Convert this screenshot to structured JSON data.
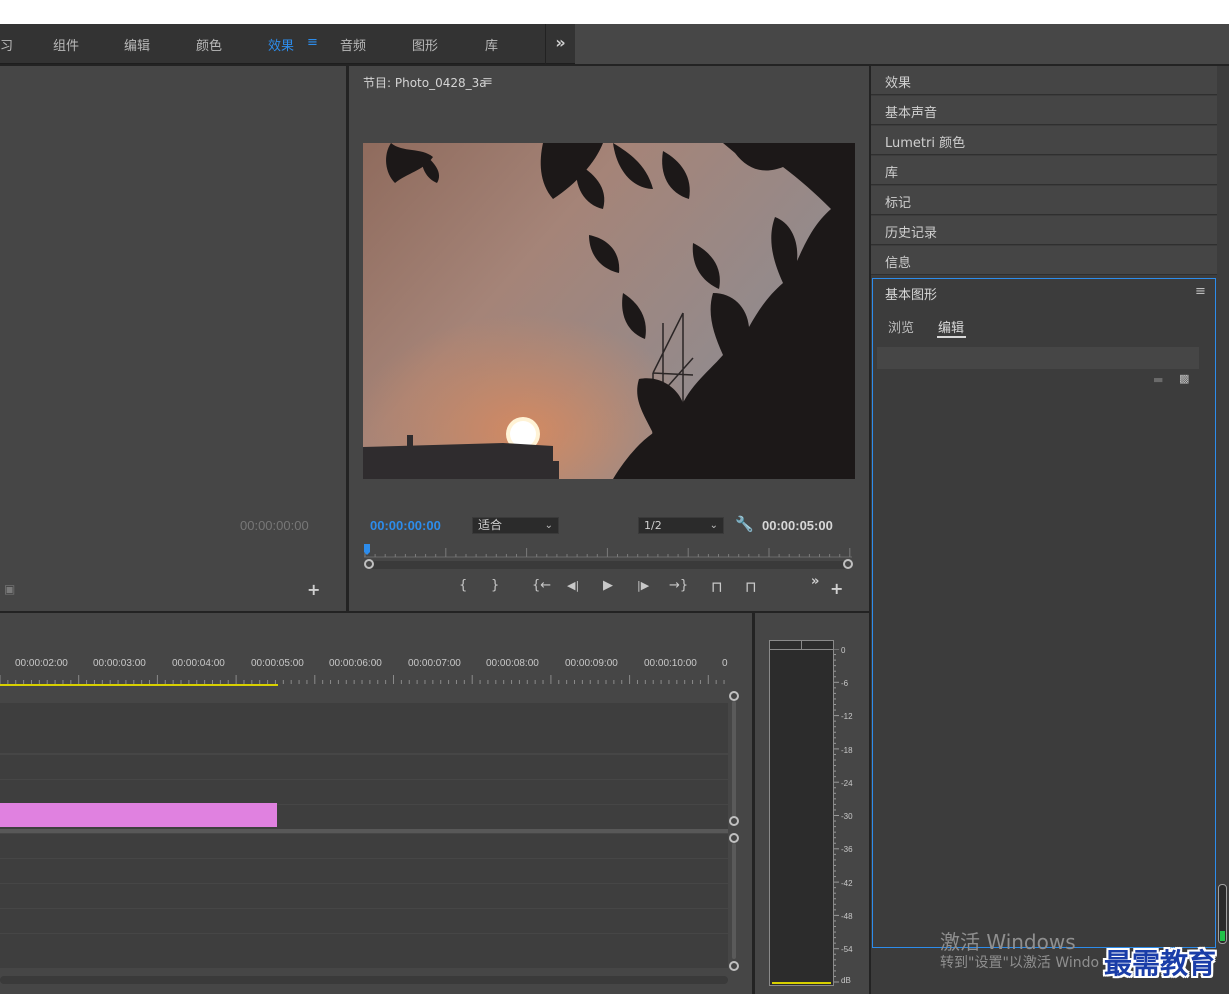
{
  "workspace": {
    "tabs": [
      {
        "label": "习",
        "active": false
      },
      {
        "label": "组件",
        "active": false
      },
      {
        "label": "编辑",
        "active": false
      },
      {
        "label": "颜色",
        "active": false
      },
      {
        "label": "效果",
        "active": true
      },
      {
        "label": "音频",
        "active": false
      },
      {
        "label": "图形",
        "active": false
      },
      {
        "label": "库",
        "active": false
      }
    ],
    "menu_icon": "hamburger-icon",
    "more_icon": "double-chevron-right-icon",
    "more_label": "»",
    "accent_color": "#2d8ceb"
  },
  "source_monitor": {
    "timecode": "00:00:00:00",
    "camera_icon": "camera-icon",
    "add_label": "+"
  },
  "program_monitor": {
    "title": "节目: Photo_0428_3a",
    "menu_label": "≡",
    "current_timecode": "00:00:00:00",
    "fit_select": "适合",
    "resolution_select": "1/2",
    "duration_timecode": "00:00:05:00",
    "wrench_icon": "wrench-icon",
    "transport": [
      {
        "icon": "mark-in-icon",
        "glyph": "{"
      },
      {
        "icon": "mark-out-icon",
        "glyph": "}"
      },
      {
        "icon": "go-to-in-icon",
        "glyph": "{←"
      },
      {
        "icon": "step-back-icon",
        "glyph": "◀|"
      },
      {
        "icon": "play-icon",
        "glyph": "▶"
      },
      {
        "icon": "step-forward-icon",
        "glyph": "|▶"
      },
      {
        "icon": "go-to-out-icon",
        "glyph": "→}"
      },
      {
        "icon": "lift-icon",
        "glyph": "⊓"
      },
      {
        "icon": "extract-icon",
        "glyph": "⊓"
      }
    ],
    "more_label": "»",
    "add_label": "+"
  },
  "timeline": {
    "ruler_labels": [
      "00:00:02:00",
      "00:00:03:00",
      "00:00:04:00",
      "00:00:05:00",
      "00:00:06:00",
      "00:00:07:00",
      "00:00:08:00",
      "00:00:09:00",
      "00:00:10:00",
      "0"
    ],
    "clip_color": "#e081e0",
    "work_area_color": "#d8d000"
  },
  "audio_meter": {
    "scale": [
      "0",
      "-6",
      "-12",
      "-18",
      "-24",
      "-30",
      "-36",
      "-42",
      "-48",
      "-54",
      "dB"
    ]
  },
  "right_panel": {
    "items": [
      "效果",
      "基本声音",
      "Lumetri 颜色",
      "库",
      "标记",
      "历史记录",
      "信息"
    ],
    "essential_graphics": {
      "title": "基本图形",
      "menu_label": "≡",
      "tab_browse": "浏览",
      "tab_edit": "编辑",
      "folder_icon": "folder-icon",
      "new_layer_icon": "new-layer-icon"
    }
  },
  "overlay": {
    "activate_title": "激活 Windows",
    "activate_sub": "转到\"设置\"以激活 Windo",
    "watermark": "最需教育"
  }
}
